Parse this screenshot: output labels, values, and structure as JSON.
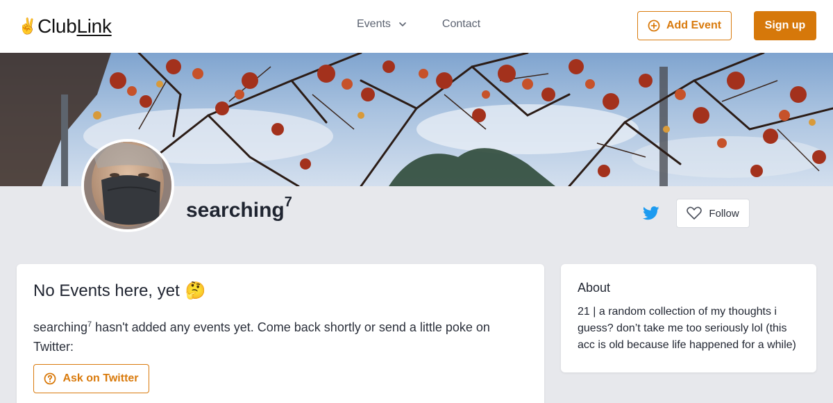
{
  "header": {
    "logo_emoji": "✌️",
    "logo_part1": "Club",
    "logo_part2": "Link",
    "nav": {
      "events_label": "Events",
      "contact_label": "Contact"
    },
    "add_event_label": "Add Event",
    "sign_up_label": "Sign up"
  },
  "profile": {
    "name": "searching",
    "name_superscript": "7",
    "follow_label": "Follow"
  },
  "events": {
    "title": "No Events here, yet",
    "title_emoji": "🤔",
    "message_name": "searching",
    "message_superscript": "7",
    "message_rest": " hasn't added any events yet. Come back shortly or send a little poke on Twitter:",
    "ask_button_label": "Ask on Twitter"
  },
  "about": {
    "title": "About",
    "text": "21 | a random collection of my thoughts i guess? don’t take me too seriously lol (this acc is old because life happened for a while)"
  },
  "icons": {
    "events_dropdown": "chevron-down-icon",
    "add_event": "plus-circle-icon",
    "twitter": "twitter-icon",
    "follow": "heart-icon",
    "ask": "help-circle-icon"
  },
  "colors": {
    "accent": "#d6780a",
    "twitter": "#1d9bf0",
    "background": "#e7e8ec"
  }
}
